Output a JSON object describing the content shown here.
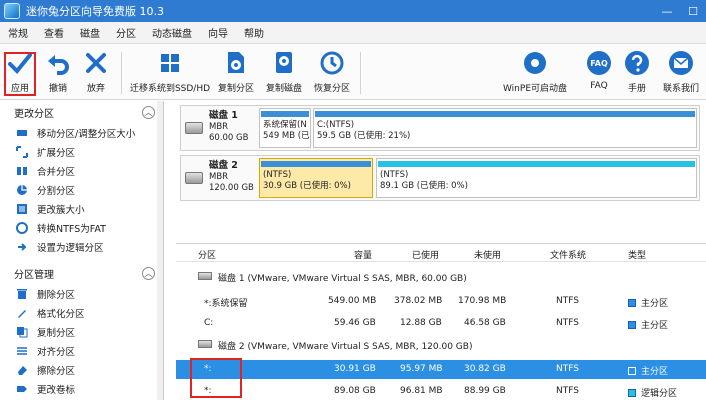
{
  "window": {
    "title": "迷你兔分区向导免费版 10.3",
    "min": "—",
    "max": "☐"
  },
  "menu": [
    "常规",
    "查看",
    "磁盘",
    "分区",
    "动态磁盘",
    "向导",
    "帮助"
  ],
  "toolbar": {
    "apply": "应用",
    "undo": "撤销",
    "discard": "放弃",
    "migrate": "迁移系统到SSD/HD",
    "copy_part": "复制分区",
    "copy_disk": "复制磁盘",
    "recover": "恢复分区",
    "winpe": "WinPE可启动盘",
    "faq": "FAQ",
    "manual": "手册",
    "contact": "联系我们",
    "faq_icon_text": "FAQ"
  },
  "sidebar": {
    "section1": "更改分区",
    "items1": [
      "移动分区/调整分区大小",
      "扩展分区",
      "合并分区",
      "分割分区",
      "更改簇大小",
      "转换NTFS为FAT",
      "设置为逻辑分区"
    ],
    "section2": "分区管理",
    "items2": [
      "删除分区",
      "格式化分区",
      "复制分区",
      "对齐分区",
      "擦除分区",
      "更改卷标"
    ]
  },
  "diskmap": {
    "disk1": {
      "name": "磁盘 1",
      "type": "MBR",
      "size": "60.00 GB",
      "parts": [
        {
          "label": "系统保留(N",
          "size": "549 MB (已使",
          "bar": "#3b8fd6"
        },
        {
          "label": "C:(NTFS)",
          "size": "59.5 GB (已使用: 21%)",
          "bar": "#3b8fd6"
        }
      ]
    },
    "disk2": {
      "name": "磁盘 2",
      "type": "MBR",
      "size": "120.00 GB",
      "parts": [
        {
          "label": "(NTFS)",
          "size": "30.9 GB (已使用: 0%)",
          "bar": "#3b8fd6"
        },
        {
          "label": "(NTFS)",
          "size": "89.1 GB (已使用: 0%)",
          "bar": "#27c2e0"
        }
      ]
    }
  },
  "table": {
    "headers": [
      "分区",
      "容量",
      "已使用",
      "未使用",
      "文件系统",
      "类型"
    ],
    "disk1_header": "磁盘 1 (VMware, VMware Virtual S SAS, MBR, 60.00 GB)",
    "disk2_header": "磁盘 2 (VMware, VMware Virtual S SAS, MBR, 120.00 GB)",
    "rows": [
      {
        "name": "*:系统保留",
        "cap": "549.00 MB",
        "used": "378.02 MB",
        "free": "170.98 MB",
        "fs": "NTFS",
        "type": "主分区"
      },
      {
        "name": "C:",
        "cap": "59.46 GB",
        "used": "12.88 GB",
        "free": "46.58 GB",
        "fs": "NTFS",
        "type": "主分区"
      },
      {
        "name": "*:",
        "cap": "30.91 GB",
        "used": "95.97 MB",
        "free": "30.82 GB",
        "fs": "NTFS",
        "type": "主分区"
      },
      {
        "name": "*:",
        "cap": "89.08 GB",
        "used": "96.81 MB",
        "free": "88.99 GB",
        "fs": "NTFS",
        "type": "逻辑分区"
      }
    ]
  },
  "colors": {
    "titlebar": "#2f7bd2",
    "accent": "#2b8fe4",
    "highlight": "#e02424"
  }
}
